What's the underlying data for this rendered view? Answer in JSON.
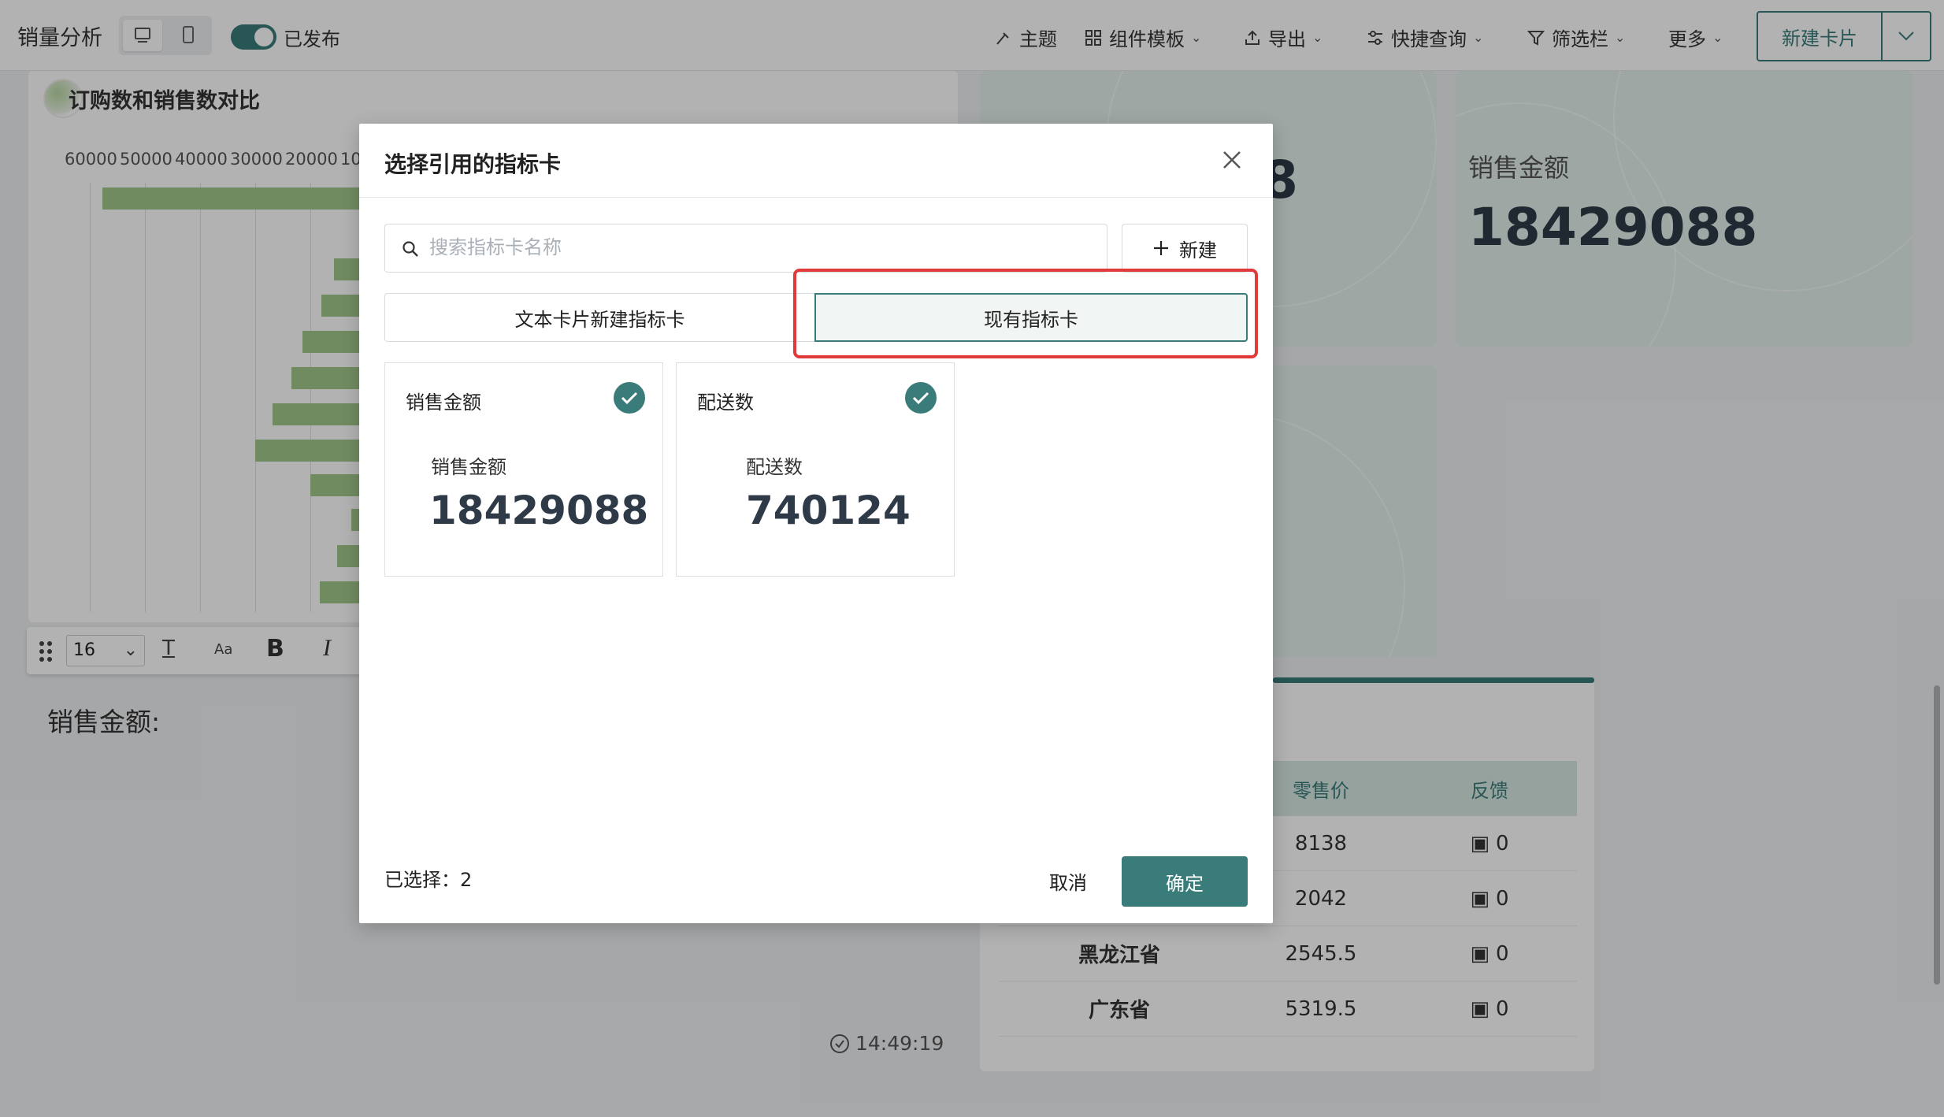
{
  "header": {
    "title": "销量分析",
    "publish_status": "已发布",
    "menu": [
      {
        "label": "主题",
        "icon": "brush-icon"
      },
      {
        "label": "组件模板",
        "icon": "grid-icon"
      },
      {
        "label": "导出",
        "icon": "export-icon"
      },
      {
        "label": "快捷查询",
        "icon": "filter-sliders-icon"
      },
      {
        "label": "筛选栏",
        "icon": "funnel-icon"
      },
      {
        "label": "更多",
        "icon": ""
      }
    ],
    "new_card_label": "新建卡片"
  },
  "dashboard": {
    "chart_title": "订购数和销售数对比",
    "axis_ticks": [
      "60000",
      "50000",
      "40000",
      "30000",
      "20000",
      "10"
    ],
    "toolbar": {
      "font_size": "16"
    },
    "text_card_label": "销售金额:",
    "timestamp": "14:49:19",
    "kpi_title": "销售金额",
    "kpi_value": "18429088",
    "kpi_partial_digit": "8",
    "table": {
      "headers": [
        "零售价",
        "反馈"
      ],
      "rows": [
        {
          "province": "",
          "price": "8138",
          "feedback": "0"
        },
        {
          "province": "",
          "price": "2042",
          "feedback": "0"
        },
        {
          "province": "黑龙江省",
          "price": "2545.5",
          "feedback": "0"
        },
        {
          "province": "广东省",
          "price": "5319.5",
          "feedback": "0"
        }
      ]
    }
  },
  "modal": {
    "title": "选择引用的指标卡",
    "search_placeholder": "搜索指标卡名称",
    "new_label": "新建",
    "tabs": [
      "文本卡片新建指标卡",
      "现有指标卡"
    ],
    "cards": [
      {
        "header": "销售金额",
        "title": "销售金额",
        "value": "18429088",
        "checked": true
      },
      {
        "header": "配送数",
        "title": "配送数",
        "value": "740124",
        "checked": true
      }
    ],
    "selected_text": "已选择：2",
    "cancel_label": "取消",
    "confirm_label": "确定"
  },
  "colors": {
    "accent": "#3a7c7a",
    "highlight": "#e03a3a",
    "bar": "#a3c78b"
  }
}
